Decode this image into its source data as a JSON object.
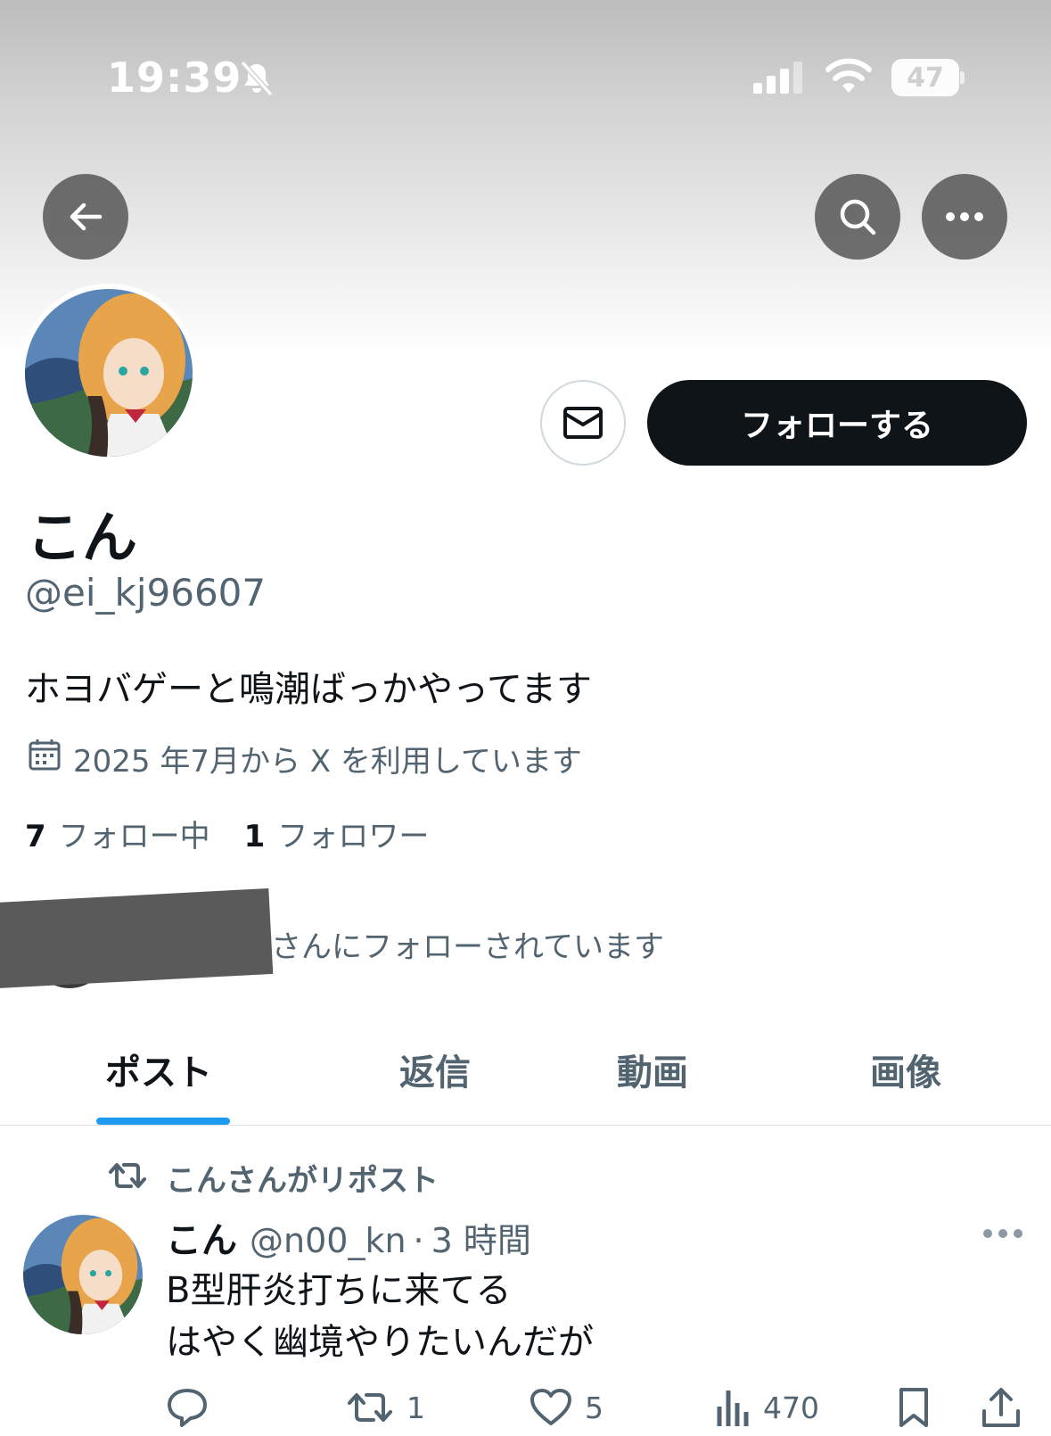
{
  "status_bar": {
    "time": "19:39",
    "battery": "47"
  },
  "profile": {
    "display_name": "こん",
    "handle": "@ei_kj96607",
    "bio": "ホヨバゲーと鳴潮ばっかやってます",
    "joined": "2025 年7月から X を利用しています",
    "following_count": "7",
    "following_label": "フォロー中",
    "followers_count": "1",
    "followers_label": "フォロワー",
    "followed_by": "さんにフォローされています"
  },
  "actions": {
    "follow_label": "フォローする"
  },
  "tabs": [
    {
      "label": "ポスト",
      "active": true
    },
    {
      "label": "返信",
      "active": false
    },
    {
      "label": "動画",
      "active": false
    },
    {
      "label": "画像",
      "active": false
    }
  ],
  "post": {
    "repost_label": "こんさんがリポスト",
    "author_name": "こん",
    "author_handle": "@n00_kn",
    "separator": "·",
    "time": "3 時間",
    "lines": [
      "B型肝炎打ちに来てる",
      "はやく幽境やりたいんだが"
    ],
    "retweets": "1",
    "likes": "5",
    "views": "470"
  },
  "colors": {
    "accent": "#1d9bf0",
    "text": "#0f1419",
    "muted": "#536471",
    "follow_button": "#0f1419"
  }
}
